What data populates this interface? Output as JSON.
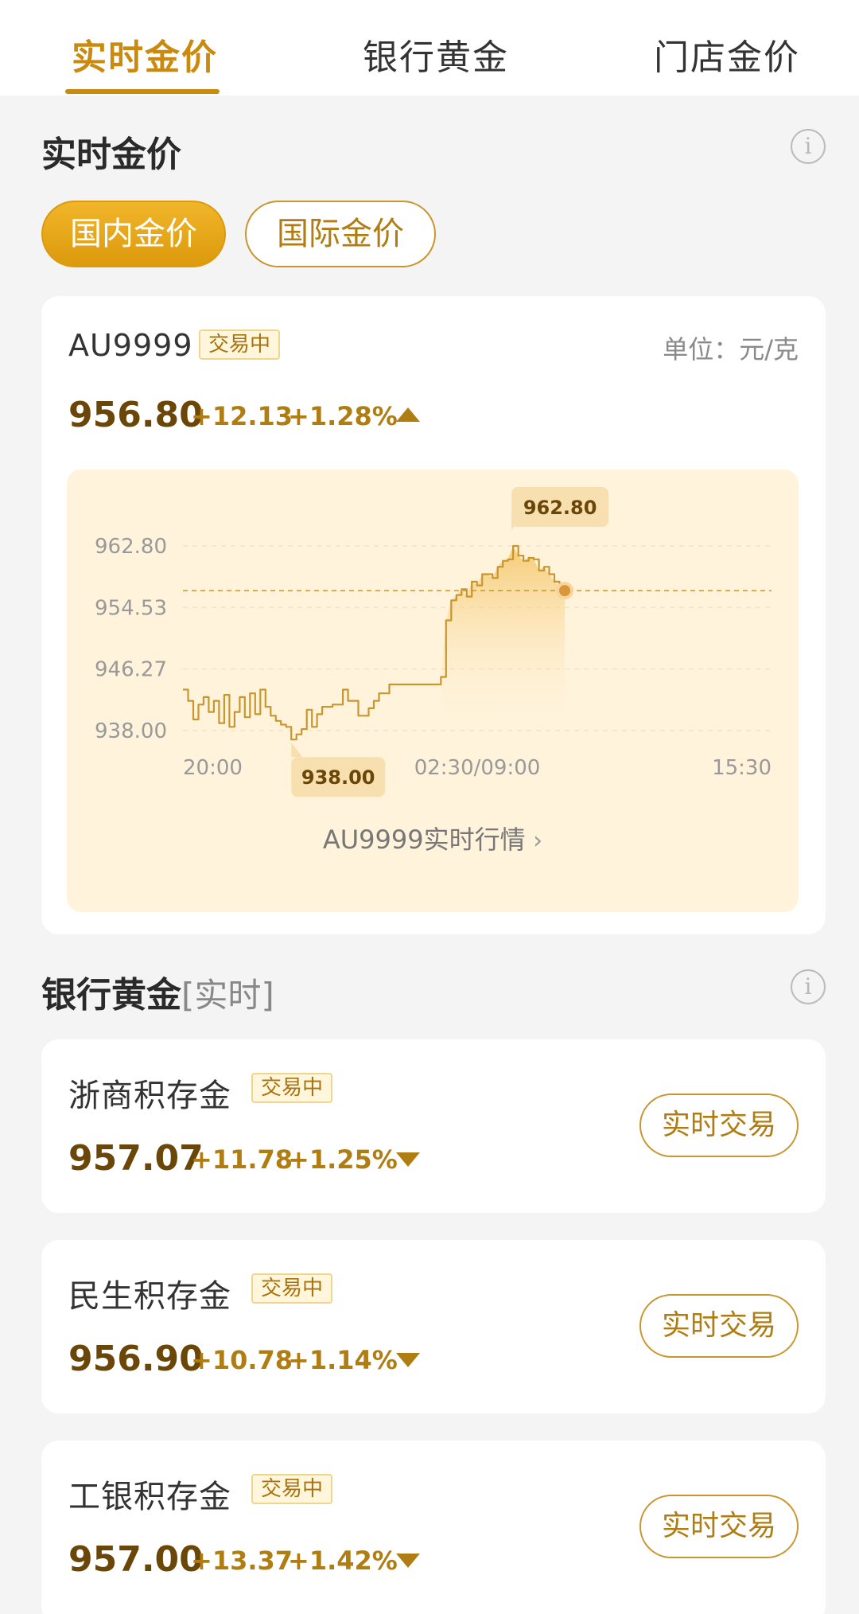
{
  "tabs": [
    {
      "label": "实时金价",
      "active": true
    },
    {
      "label": "银行黄金",
      "active": false
    },
    {
      "label": "门店金价",
      "active": false
    }
  ],
  "realtime": {
    "title": "实时金价",
    "info_icon": "info-icon",
    "filters": [
      {
        "label": "国内金价",
        "active": true
      },
      {
        "label": "国际金价",
        "active": false
      }
    ],
    "au": {
      "name": "AU9999",
      "status": "交易中",
      "unit": "单位：元/克",
      "price": "956.80",
      "change": "+12.13",
      "percent": "+1.28%",
      "trend": "up",
      "link_label": "AU9999实时行情",
      "link_icon": "chevron-right-icon"
    }
  },
  "chart_data": {
    "type": "line",
    "y_ticks": [
      "962.80",
      "954.53",
      "946.27",
      "938.00"
    ],
    "x_ticks": [
      "20:00",
      "02:30/09:00",
      "15:30"
    ],
    "ylim": [
      938.0,
      962.8
    ],
    "reference_value": 956.8,
    "max_label": "962.80",
    "min_label": "938.00",
    "grid": true,
    "series": [
      {
        "values": [
          943.5,
          942.0,
          939.5,
          941.5,
          942.5,
          940.5,
          942.0,
          939.0,
          942.8,
          938.5,
          940.5,
          942.5,
          939.8,
          943.0,
          940.2,
          943.5,
          941.2,
          940.0,
          939.3,
          938.8,
          938.5,
          936.8,
          937.5,
          938.2,
          940.8,
          938.5,
          940.2,
          941.2,
          941.2,
          941.5,
          941.5,
          943.5,
          942.0,
          942.0,
          940.0,
          940.0,
          941.0,
          942.0,
          943.0,
          943.0,
          944.2,
          944.2,
          944.2,
          944.2,
          944.2,
          944.2,
          944.2,
          944.2,
          944.2,
          944.2,
          945.2,
          952.8,
          955.5,
          956.2,
          957.0,
          956.0,
          958.0,
          957.5,
          959.0,
          959.0,
          958.5,
          960.0,
          960.8,
          961.0,
          962.8,
          961.5,
          960.8,
          961.2,
          961.0,
          959.5,
          960.0,
          959.0,
          958.0,
          957.5,
          956.8
        ]
      }
    ]
  },
  "bank": {
    "title": "银行黄金",
    "subtitle": "[实时]",
    "info_icon": "info-icon",
    "items": [
      {
        "name": "浙商积存金",
        "status": "交易中",
        "price": "957.07",
        "change": "+11.78",
        "percent": "+1.25%",
        "trend": "down",
        "button": "实时交易"
      },
      {
        "name": "民生积存金",
        "status": "交易中",
        "price": "956.90",
        "change": "+10.78",
        "percent": "+1.14%",
        "trend": "down",
        "button": "实时交易"
      },
      {
        "name": "工银积存金",
        "status": "交易中",
        "price": "957.00",
        "change": "+13.37",
        "percent": "+1.42%",
        "trend": "down",
        "button": "实时交易"
      }
    ]
  },
  "colors": {
    "accent": "#c98a0e",
    "price": "#6a4708",
    "chart_bg": "#fff3db"
  }
}
